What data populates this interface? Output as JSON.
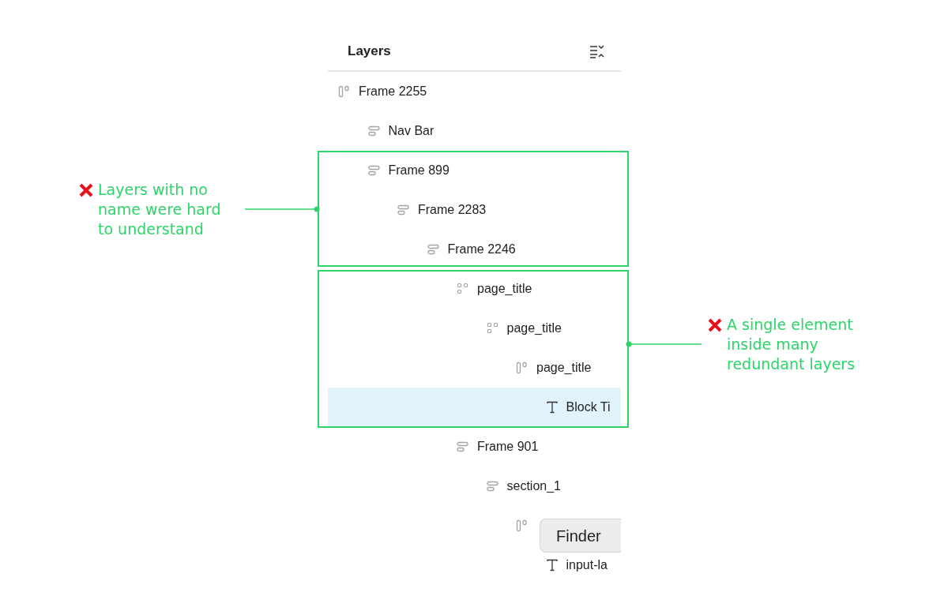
{
  "panel": {
    "title": "Layers"
  },
  "layers": [
    {
      "name": "Frame 2255",
      "kind": "column",
      "selected": false,
      "children": [
        {
          "name": "Nav Bar",
          "kind": "row",
          "selected": false
        },
        {
          "name": "Frame 899",
          "kind": "row",
          "selected": false,
          "children": [
            {
              "name": "Frame 2283",
              "kind": "row",
              "selected": false,
              "children": [
                {
                  "name": "Frame 2246",
                  "kind": "row",
                  "selected": false,
                  "children": [
                    {
                      "name": "page_title",
                      "kind": "grid",
                      "selected": false,
                      "children": [
                        {
                          "name": "page_title",
                          "kind": "grid",
                          "selected": false,
                          "children": [
                            {
                              "name": "page_title",
                              "kind": "column",
                              "selected": false,
                              "children": [
                                {
                                  "name": "Block Ti",
                                  "kind": "text",
                                  "selected": true
                                }
                              ]
                            }
                          ]
                        }
                      ]
                    },
                    {
                      "name": "Frame 901",
                      "kind": "row",
                      "selected": false,
                      "children": [
                        {
                          "name": "section_1",
                          "kind": "row",
                          "selected": false,
                          "children": [
                            {
                              "kind": "column",
                              "selected": false,
                              "children": [
                                {
                                  "name": "input-la",
                                  "kind": "text",
                                  "selected": false
                                }
                              ]
                            }
                          ]
                        }
                      ]
                    }
                  ]
                }
              ]
            }
          ]
        }
      ]
    }
  ],
  "tooltip": {
    "text": "Finder"
  },
  "annotations": [
    {
      "text": "Layers with no name were hard to understand"
    },
    {
      "text": "A single element inside many redundant layers"
    }
  ]
}
